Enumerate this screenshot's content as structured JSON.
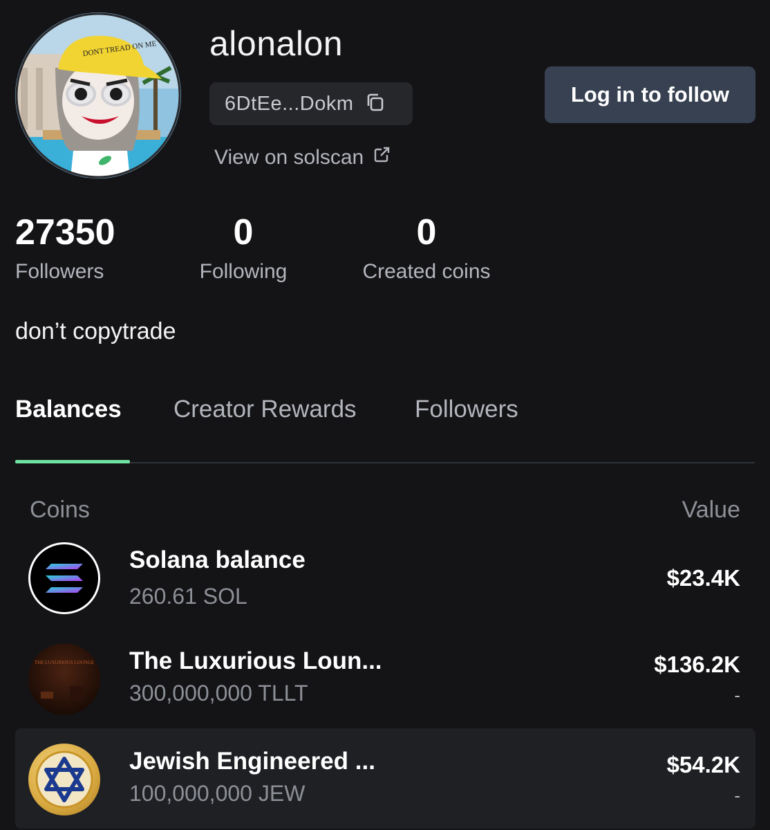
{
  "profile": {
    "username": "alonalon",
    "address_short": "6DtEe...Dokm",
    "solscan_label": "View on solscan",
    "follow_label": "Log in to follow",
    "avatar_hat_text": "DONT TREAD ON ME",
    "bio": "don’t copytrade"
  },
  "stats": {
    "followers_count": "27350",
    "followers_label": "Followers",
    "following_count": "0",
    "following_label": "Following",
    "created_count": "0",
    "created_label": "Created coins"
  },
  "tabs": [
    {
      "label": "Balances",
      "active": true
    },
    {
      "label": "Creator Rewards",
      "active": false
    },
    {
      "label": "Followers",
      "active": false
    }
  ],
  "table": {
    "col_coins": "Coins",
    "col_value": "Value",
    "rows": [
      {
        "name": "Solana balance",
        "amount": "260.61 SOL",
        "value": "$23.4K",
        "change": "",
        "icon": "solana-logo-icon"
      },
      {
        "name": "The Luxurious Loun...",
        "amount": "300,000,000 TLLT",
        "value": "$136.2K",
        "change": "-",
        "icon": "luxurious-lounge-coin-icon",
        "icon_text": "THE LUXURIOUS LOUNGE"
      },
      {
        "name": "Jewish Engineered ...",
        "amount": "100,000,000 JEW",
        "value": "$54.2K",
        "change": "-",
        "icon": "star-of-david-coin-icon"
      }
    ]
  },
  "colors": {
    "background": "#141417",
    "accent": "#6fe3a0",
    "button_bg": "#374151"
  }
}
